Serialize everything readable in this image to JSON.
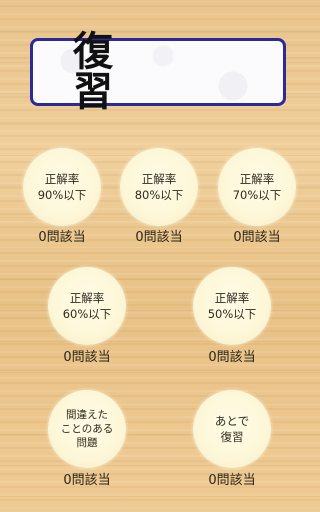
{
  "title": "復　習",
  "buttons": [
    {
      "label": "正解率\n90%以下",
      "count": "0問該当"
    },
    {
      "label": "正解率\n80%以下",
      "count": "0問該当"
    },
    {
      "label": "正解率\n70%以下",
      "count": "0問該当"
    },
    {
      "label": "正解率\n60%以下",
      "count": "0問該当"
    },
    {
      "label": "正解率\n50%以下",
      "count": "0問該当"
    },
    {
      "label": "間違えた\nことのある\n問題",
      "count": "0問該当"
    },
    {
      "label": "あとで\n復習",
      "count": "0問該当"
    }
  ]
}
